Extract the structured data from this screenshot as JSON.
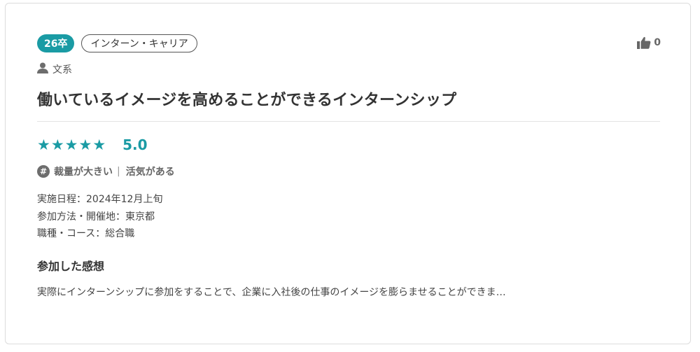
{
  "review": {
    "graduation_badge": "26卒",
    "category": "インターン・キャリア",
    "like_count": "0",
    "user_type": "文系",
    "title": "働いているイメージを高めることができるインターンシップ",
    "rating": {
      "stars": 5,
      "max_stars": 5,
      "score": "5.0",
      "star_glyph": "★"
    },
    "tags": [
      "裁量が大きい",
      "活気がある"
    ],
    "tag_separator": "|",
    "details": {
      "date": "実施日程：2024年12月上旬",
      "method_location": "参加方法・開催地：東京都",
      "job_course": "職種・コース：総合職"
    },
    "impressions_heading": "参加した感想",
    "impressions_excerpt": "実際にインターンシップに参加をすることで、企業に入社後の仕事のイメージを膨らませることができま…"
  },
  "colors": {
    "accent": "#1a9ba4",
    "text": "#333333",
    "muted": "#666666",
    "border": "#dcdcdc"
  },
  "icons": {
    "like": "thumbs-up-icon",
    "user": "person-icon",
    "tag": "hash-icon"
  }
}
